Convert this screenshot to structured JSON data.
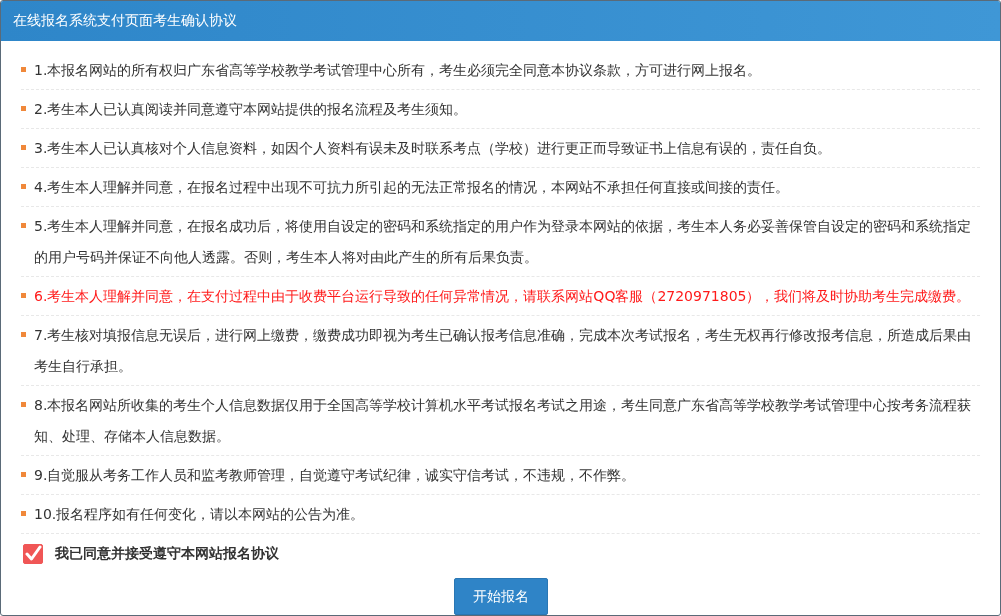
{
  "window": {
    "title": "在线报名系统支付页面考生确认协议"
  },
  "terms": [
    {
      "text": "1.本报名网站的所有权归广东省高等学校教学考试管理中心所有，考生必须完全同意本协议条款，方可进行网上报名。",
      "highlighted": false
    },
    {
      "text": "2.考生本人已认真阅读并同意遵守本网站提供的报名流程及考生须知。",
      "highlighted": false
    },
    {
      "text": "3.考生本人已认真核对个人信息资料，如因个人资料有误未及时联系考点（学校）进行更正而导致证书上信息有误的，责任自负。",
      "highlighted": false
    },
    {
      "text": "4.考生本人理解并同意，在报名过程中出现不可抗力所引起的无法正常报名的情况，本网站不承担任何直接或间接的责任。",
      "highlighted": false
    },
    {
      "text": "5.考生本人理解并同意，在报名成功后，将使用自设定的密码和系统指定的用户作为登录本网站的依据，考生本人务必妥善保管自设定的密码和系统指定的用户号码并保证不向他人透露。否则，考生本人将对由此产生的所有后果负责。",
      "highlighted": false
    },
    {
      "text": "6.考生本人理解并同意，在支付过程中由于收费平台运行导致的任何异常情况，请联系网站QQ客服（2720971805），我们将及时协助考生完成缴费。",
      "highlighted": true
    },
    {
      "text": "7.考生核对填报信息无误后，进行网上缴费，缴费成功即视为考生已确认报考信息准确，完成本次考试报名，考生无权再行修改报考信息，所造成后果由考生自行承担。",
      "highlighted": false
    },
    {
      "text": "8.本报名网站所收集的考生个人信息数据仅用于全国高等学校计算机水平考试报名考试之用途，考生同意广东省高等学校教学考试管理中心按考务流程获知、处理、存储本人信息数据。",
      "highlighted": false
    },
    {
      "text": "9.自觉服从考务工作人员和监考教师管理，自觉遵守考试纪律，诚实守信考试，不违规，不作弊。",
      "highlighted": false
    },
    {
      "text": "10.报名程序如有任何变化，请以本网站的公告为准。",
      "highlighted": false
    }
  ],
  "agreement": {
    "label": "我已同意并接受遵守本网站报名协议",
    "checked": true
  },
  "start_button": {
    "label": "开始报名"
  }
}
